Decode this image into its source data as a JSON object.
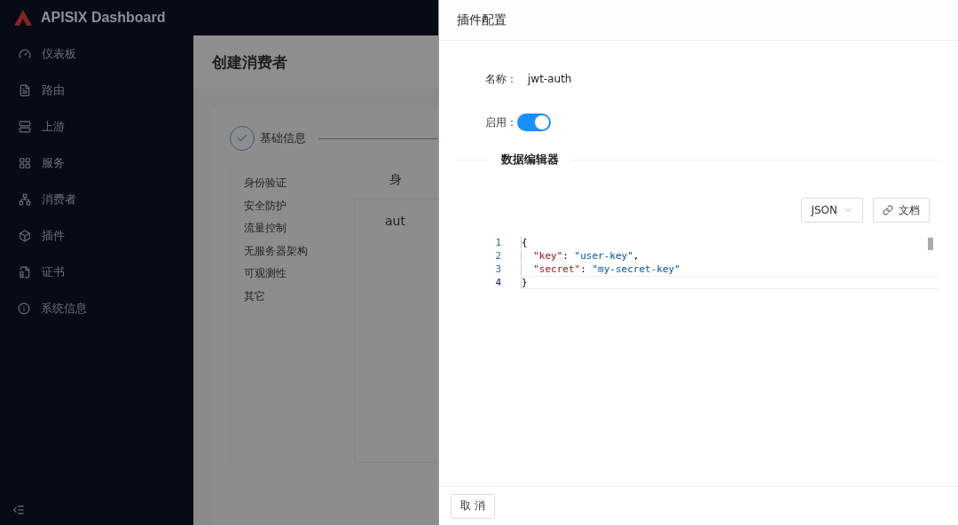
{
  "app": {
    "title": "APISIX Dashboard"
  },
  "sidebar": {
    "items": [
      {
        "label": "仪表板",
        "selected": false
      },
      {
        "label": "路由",
        "selected": false
      },
      {
        "label": "上游",
        "selected": false
      },
      {
        "label": "服务",
        "selected": false
      },
      {
        "label": "消费者",
        "selected": false
      },
      {
        "label": "插件",
        "selected": false
      },
      {
        "label": "证书",
        "selected": false
      },
      {
        "label": "系统信息",
        "selected": false
      }
    ]
  },
  "page": {
    "title": "创建消费者",
    "steps": [
      {
        "label": "基础信息",
        "done": true
      }
    ],
    "categories": [
      "身份验证",
      "安全防护",
      "流量控制",
      "无服务器架构",
      "可观测性",
      "其它"
    ],
    "section_heading": "身",
    "card_text": "aut"
  },
  "drawer": {
    "title": "插件配置",
    "name_label": "名称：",
    "name_value": "jwt-auth",
    "enable_label": "启用：",
    "enabled": true,
    "editor_heading": "数据编辑器",
    "format_select": "JSON",
    "docs_button": "文档",
    "code_lines": [
      {
        "number": "1",
        "active": false,
        "tokens": [
          {
            "kind": "punct",
            "text": "{"
          }
        ]
      },
      {
        "number": "2",
        "active": false,
        "tokens": [
          {
            "kind": "key",
            "text": "  \"key\""
          },
          {
            "kind": "punct",
            "text": ": "
          },
          {
            "kind": "string",
            "text": "\"user-key\""
          },
          {
            "kind": "punct",
            "text": ","
          }
        ]
      },
      {
        "number": "3",
        "active": false,
        "tokens": [
          {
            "kind": "key",
            "text": "  \"secret\""
          },
          {
            "kind": "punct",
            "text": ": "
          },
          {
            "kind": "string",
            "text": "\"my-secret-key\""
          }
        ]
      },
      {
        "number": "4",
        "active": true,
        "tokens": [
          {
            "kind": "punct",
            "text": "}"
          }
        ]
      }
    ],
    "cancel_button": "取 消"
  }
}
